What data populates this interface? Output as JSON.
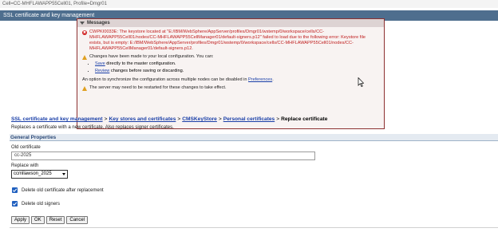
{
  "topbar": {
    "text": "Cell=CC-MHFLAWAPP55Cell01, Profile=Dmgr01"
  },
  "titlebar": {
    "title": "SSL certificate and key management"
  },
  "messages": {
    "header": "Messages",
    "error": "CWPKI0033E: The keystore located at \"E:/IBM/WebSphere/AppServer/profiles/Dmgr01/wstemp/0/workspace/cells/CC-MHFLAWAPP55Cell01/nodes/CC-MHFLAWAPP55CellManager01/default-signers.p12\" failed to load due to the following error: Keystore file exists, but is empty: E:/IBM/WebSphere/AppServer/profiles/Dmgr01/wstemp/0/workspace/cells/CC-MHFLAWAPP55Cell01/nodes/CC-MHFLAWAPP55CellManager01/default-signers.p12.",
    "changes_intro": "Changes have been made to your local configuration. You can:",
    "save_link": "Save",
    "save_rest": " directly to the master configuration.",
    "review_link": "Review",
    "review_rest": " changes before saving or discarding.",
    "sync_text": "An option to synchronize the configuration across multiple nodes can be disabled in ",
    "prefs_link": "Preferences",
    "sync_end": ".",
    "restart_text": "The server may need to be restarted for these changes to take effect."
  },
  "breadcrumb": {
    "items": [
      "SSL certificate and key management",
      "Key stores and certificates",
      "CMSKeyStore",
      "Personal certificates"
    ],
    "separator": ">",
    "current": "Replace certificate"
  },
  "page": {
    "description": "Replaces a certificate with a new certificate. Also replaces signer certificates.",
    "general_properties": "General Properties"
  },
  "form": {
    "old_cert_label": "Old certificate",
    "old_cert_value": "cc-2025",
    "replace_with_label": "Replace with",
    "replace_with_value": "ccmllawson_2025",
    "delete_old_cert_label": "Delete old certificate after replacement",
    "delete_old_cert_checked": true,
    "delete_old_signers_label": "Delete old signers",
    "delete_old_signers_checked": true
  },
  "buttons": {
    "apply": "Apply",
    "ok": "OK",
    "reset": "Reset",
    "cancel": "Cancel"
  },
  "colors": {
    "titlebar": "#4e6e8e",
    "error": "#c02020",
    "link": "#1a3fa8",
    "checkbox": "#1f5fbf"
  }
}
